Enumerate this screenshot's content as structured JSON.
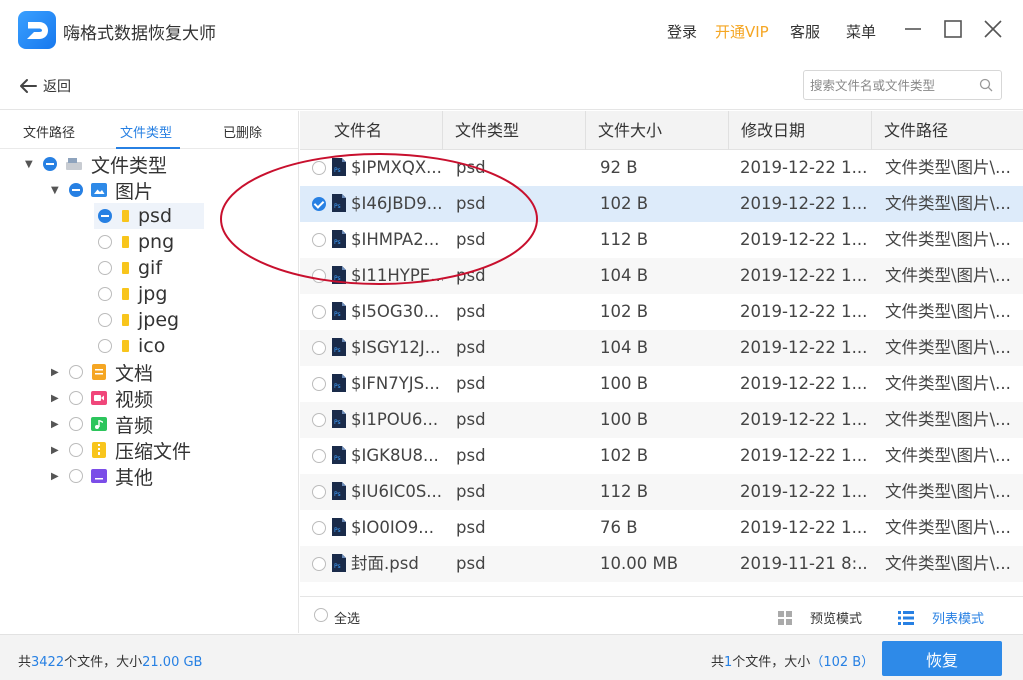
{
  "app": {
    "title": "嗨格式数据恢复大师",
    "login": "登录",
    "vip": "开通VIP",
    "service": "客服",
    "menu": "菜单"
  },
  "nav": {
    "back_label": "返回",
    "search_placeholder": "搜索文件名或文件类型"
  },
  "sidebar": {
    "tabs": [
      "文件路径",
      "文件类型",
      "已删除"
    ],
    "active_tab": "文件类型",
    "tree": {
      "root": "文件类型",
      "images": "图片",
      "image_types": [
        "psd",
        "png",
        "gif",
        "jpg",
        "jpeg",
        "ico"
      ],
      "others": [
        {
          "label": "文档",
          "icon": "document-folder-icon",
          "color": "#f5a623"
        },
        {
          "label": "视频",
          "icon": "video-folder-icon",
          "color": "#f0467a"
        },
        {
          "label": "音频",
          "icon": "audio-folder-icon",
          "color": "#2cc55c"
        },
        {
          "label": "压缩文件",
          "icon": "archive-folder-icon",
          "color": "#f8c51c"
        },
        {
          "label": "其他",
          "icon": "other-folder-icon",
          "color": "#7b4de8"
        }
      ]
    }
  },
  "table": {
    "columns": [
      "文件名",
      "文件类型",
      "文件大小",
      "修改日期",
      "文件路径"
    ],
    "rows": [
      {
        "name": "$IPMXQX...",
        "type": "psd",
        "size": "92 B",
        "date": "2019-12-22 1...",
        "path": "文件类型\\图片\\..."
      },
      {
        "name": "$I46JBD9...",
        "type": "psd",
        "size": "102 B",
        "date": "2019-12-22 1...",
        "path": "文件类型\\图片\\..."
      },
      {
        "name": "$IHMPA2...",
        "type": "psd",
        "size": "112 B",
        "date": "2019-12-22 1...",
        "path": "文件类型\\图片\\..."
      },
      {
        "name": "$I11HYPE...",
        "type": "psd",
        "size": "104 B",
        "date": "2019-12-22 1...",
        "path": "文件类型\\图片\\..."
      },
      {
        "name": "$I5OG30...",
        "type": "psd",
        "size": "102 B",
        "date": "2019-12-22 1...",
        "path": "文件类型\\图片\\..."
      },
      {
        "name": "$ISGY12J...",
        "type": "psd",
        "size": "104 B",
        "date": "2019-12-22 1...",
        "path": "文件类型\\图片\\..."
      },
      {
        "name": "$IFN7YJS...",
        "type": "psd",
        "size": "100 B",
        "date": "2019-12-22 1...",
        "path": "文件类型\\图片\\..."
      },
      {
        "name": "$I1POU6...",
        "type": "psd",
        "size": "100 B",
        "date": "2019-12-22 1...",
        "path": "文件类型\\图片\\..."
      },
      {
        "name": "$IGK8U8...",
        "type": "psd",
        "size": "102 B",
        "date": "2019-12-22 1...",
        "path": "文件类型\\图片\\..."
      },
      {
        "name": "$IU6IC0S...",
        "type": "psd",
        "size": "112 B",
        "date": "2019-12-22 1...",
        "path": "文件类型\\图片\\..."
      },
      {
        "name": "$IO0IO9...",
        "type": "psd",
        "size": "76 B",
        "date": "2019-12-22 1...",
        "path": "文件类型\\图片\\..."
      },
      {
        "name": "封面.psd",
        "type": "psd",
        "size": "10.00 MB",
        "date": "2019-11-21 8:...",
        "path": "文件类型\\图片\\..."
      }
    ],
    "selected_row": 1
  },
  "footer": {
    "select_all": "全选",
    "preview_mode": "预览模式",
    "list_mode": "列表模式"
  },
  "status": {
    "total_prefix": "共",
    "total_count": "3422",
    "total_mid": "个文件，大小",
    "total_size": "21.00 GB",
    "sel_prefix": "共",
    "sel_count": "1",
    "sel_mid": "个文件，大小",
    "sel_size": "（102 B）",
    "recover": "恢复"
  },
  "colors": {
    "accent": "#2780e3",
    "vip": "#f5a623",
    "annotation": "#c8102e"
  }
}
